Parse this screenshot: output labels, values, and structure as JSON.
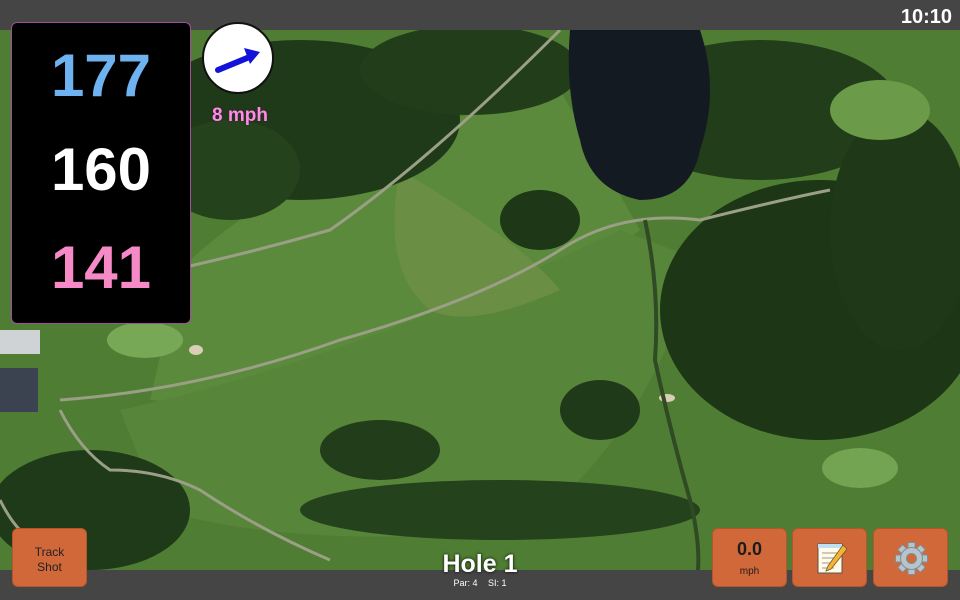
{
  "status_bar": {
    "time": "10:10"
  },
  "yardage": {
    "back": "177",
    "middle": "160",
    "front": "141"
  },
  "wind": {
    "speed_label": "8 mph",
    "icon": "wind-arrow-icon"
  },
  "hole": {
    "title": "Hole 1",
    "par": "Par: 4",
    "stroke_index": "SI: 1"
  },
  "buttons": {
    "track_line1": "Track",
    "track_line2": "Shot",
    "speed_value": "0.0",
    "speed_unit": "mph",
    "notes_icon": "notepad-icon",
    "settings_icon": "gear-icon"
  },
  "colors": {
    "button": "#d0683a",
    "back_yardage": "#6fb2f0",
    "middle_yardage": "#ffffff",
    "front_yardage": "#f58ac6",
    "wind_text": "#ff8be4",
    "wind_arrow": "#1212d8"
  }
}
